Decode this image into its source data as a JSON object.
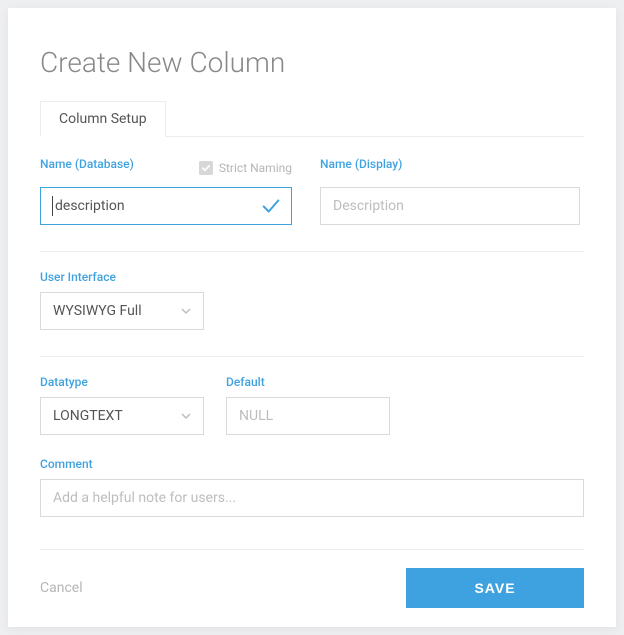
{
  "title": "Create New Column",
  "tabs": {
    "column_setup": "Column Setup"
  },
  "fields": {
    "name_db": {
      "label": "Name (Database)",
      "value": "description"
    },
    "strict_naming": {
      "label": "Strict Naming"
    },
    "name_display": {
      "label": "Name (Display)",
      "placeholder": "Description"
    },
    "ui": {
      "label": "User Interface",
      "value": "WYSIWYG Full"
    },
    "datatype": {
      "label": "Datatype",
      "value": "LONGTEXT"
    },
    "default": {
      "label": "Default",
      "placeholder": "NULL"
    },
    "comment": {
      "label": "Comment",
      "placeholder": "Add a helpful note for users..."
    }
  },
  "actions": {
    "cancel": "Cancel",
    "save": "SAVE"
  }
}
